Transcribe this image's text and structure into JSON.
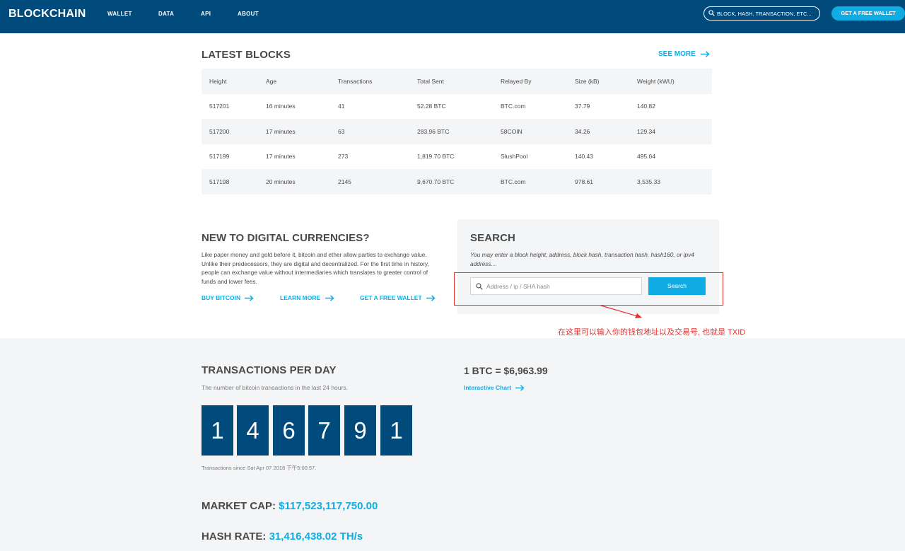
{
  "header": {
    "logo": "BLOCKCHAIN",
    "nav": [
      "WALLET",
      "DATA",
      "API",
      "ABOUT"
    ],
    "search_placeholder": "BLOCK, HASH, TRANSACTION, ETC...",
    "wallet_button": "GET A FREE WALLET"
  },
  "latest_blocks": {
    "title": "LATEST BLOCKS",
    "see_more": "SEE MORE",
    "columns": [
      "Height",
      "Age",
      "Transactions",
      "Total Sent",
      "Relayed By",
      "Size (kB)",
      "Weight (kWU)"
    ],
    "rows": [
      [
        "517201",
        "16 minutes",
        "41",
        "52.28 BTC",
        "BTC.com",
        "37.79",
        "140.82"
      ],
      [
        "517200",
        "17 minutes",
        "63",
        "283.96 BTC",
        "58COIN",
        "34.26",
        "129.34"
      ],
      [
        "517199",
        "17 minutes",
        "273",
        "1,819.70 BTC",
        "SlushPool",
        "140.43",
        "495.64"
      ],
      [
        "517198",
        "20 minutes",
        "2145",
        "9,670.70 BTC",
        "BTC.com",
        "978.61",
        "3,535.33"
      ]
    ]
  },
  "intro": {
    "title": "NEW TO DIGITAL CURRENCIES?",
    "text": "Like paper money and gold before it, bitcoin and ether allow parties to exchange value. Unlike their predecessors, they are digital and decentralized. For the first time in history, people can exchange value without intermediaries which translates to greater control of funds and lower fees.",
    "links": [
      "BUY BITCOIN",
      "LEARN MORE",
      "GET A FREE WALLET"
    ]
  },
  "search": {
    "title": "SEARCH",
    "description": "You may enter a block height, address, block hash, transaction hash, hash160, or ipv4 address...",
    "placeholder": "Address / ip / SHA hash",
    "button": "Search"
  },
  "annotation": {
    "text": "在这里可以输入你的钱包地址以及交易号, 也就是 TXID",
    "color": "#e5312f"
  },
  "stats": {
    "tx_title": "TRANSACTIONS PER DAY",
    "tx_subtitle": "The number of bitcoin transactions in the last 24 hours.",
    "tx_digits": [
      "1",
      "4",
      "6",
      "7",
      "9",
      "1"
    ],
    "tx_since": "Transactions since Sat Apr 07 2018 下午5:00:57.",
    "price": "1 BTC = $6,963.99",
    "chart_link": "Interactive Chart",
    "market_cap_label": "MARKET CAP:",
    "market_cap_value": "$117,523,117,750.00",
    "hash_rate_label": "HASH RATE:",
    "hash_rate_value": "31,416,438.02 TH/s"
  },
  "colors": {
    "header_bg": "#004a7c",
    "accent": "#10ade4",
    "panel_bg": "#f4f5f7"
  }
}
